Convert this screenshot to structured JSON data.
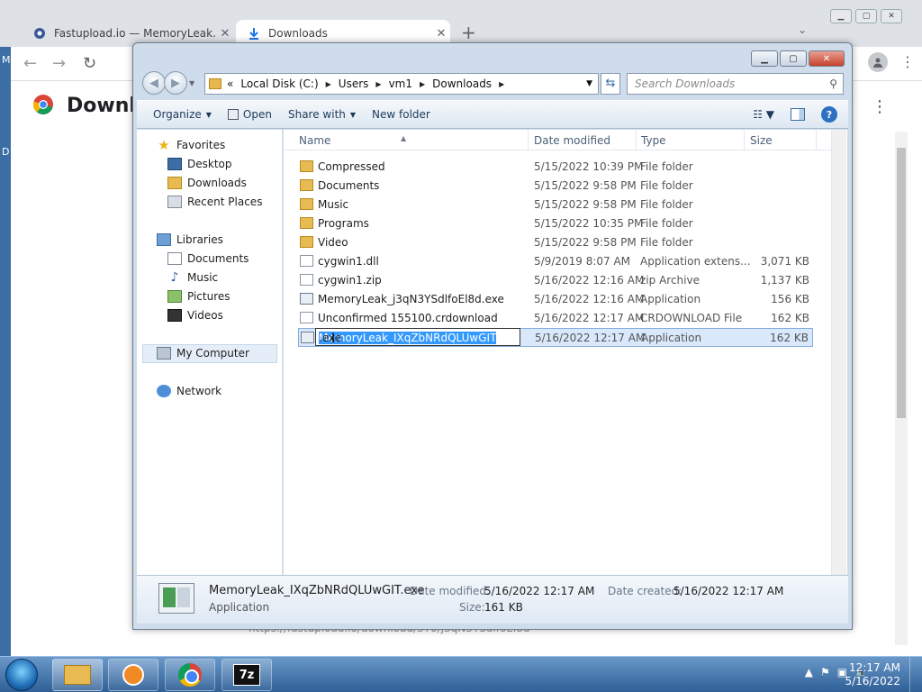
{
  "browser": {
    "tabs": [
      {
        "title": "Fastupload.io — MemoryLeak.ex",
        "close": "✕"
      },
      {
        "title": "Downloads",
        "close": "✕"
      }
    ],
    "page_title": "Downlo",
    "hidden_url": "https://fastupload.io/download/3Y0/j3qN3YSdlfoEl8d"
  },
  "desktop_fragments": [
    "M",
    "D"
  ],
  "explorer": {
    "breadcrumb": [
      "«",
      "Local Disk (C:)",
      "Users",
      "vm1",
      "Downloads"
    ],
    "search_placeholder": "Search Downloads",
    "toolbar": {
      "organize": "Organize",
      "open": "Open",
      "share_with": "Share with",
      "new_folder": "New folder"
    },
    "nav": {
      "favorites": "Favorites",
      "desktop": "Desktop",
      "downloads": "Downloads",
      "recent_places": "Recent Places",
      "libraries": "Libraries",
      "documents": "Documents",
      "music": "Music",
      "pictures": "Pictures",
      "videos": "Videos",
      "my_computer": "My Computer",
      "network": "Network"
    },
    "columns": {
      "name": "Name",
      "date": "Date modified",
      "type": "Type",
      "size": "Size"
    },
    "files": [
      {
        "name": "Compressed",
        "date": "5/15/2022 10:39 PM",
        "type": "File folder",
        "size": ""
      },
      {
        "name": "Documents",
        "date": "5/15/2022 9:58 PM",
        "type": "File folder",
        "size": ""
      },
      {
        "name": "Music",
        "date": "5/15/2022 9:58 PM",
        "type": "File folder",
        "size": ""
      },
      {
        "name": "Programs",
        "date": "5/15/2022 10:35 PM",
        "type": "File folder",
        "size": ""
      },
      {
        "name": "Video",
        "date": "5/15/2022 9:58 PM",
        "type": "File folder",
        "size": ""
      },
      {
        "name": "cygwin1.dll",
        "date": "5/9/2019 8:07 AM",
        "type": "Application extens...",
        "size": "3,071 KB"
      },
      {
        "name": "cygwin1.zip",
        "date": "5/16/2022 12:16 AM",
        "type": "zip Archive",
        "size": "1,137 KB"
      },
      {
        "name": "MemoryLeak_j3qN3YSdlfoEl8d.exe",
        "date": "5/16/2022 12:16 AM",
        "type": "Application",
        "size": "156 KB"
      },
      {
        "name": "Unconfirmed 155100.crdownload",
        "date": "5/16/2022 12:17 AM",
        "type": "CRDOWNLOAD File",
        "size": "162 KB"
      },
      {
        "name": "MemoryLeak_IXqZbNRdQLUwGIT.exe",
        "date": "5/16/2022 12:17 AM",
        "type": "Application",
        "size": "162 KB"
      }
    ],
    "rename": {
      "selected_part": "MemoryLeak_IXqZbNRdQLUwGIT",
      "extension": ".exe"
    },
    "details": {
      "name": "MemoryLeak_IXqZbNRdQLUwGIT.exe",
      "kind": "Application",
      "date_modified_label": "Date modified:",
      "date_modified": "5/16/2022 12:17 AM",
      "size_label": "Size:",
      "size": "161 KB",
      "date_created_label": "Date created:",
      "date_created": "5/16/2022 12:17 AM"
    }
  },
  "taskbar": {
    "time": "12:17 AM",
    "date": "5/16/2022",
    "seven_zip": "7z"
  }
}
